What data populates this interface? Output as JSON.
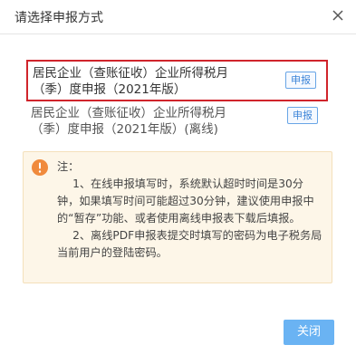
{
  "dialog": {
    "title": "请选择申报方式",
    "close_icon": "close-icon"
  },
  "options": [
    {
      "label_line1": "居民企业（查账征收）企业所得税月",
      "label_line2": "（季）度申报（2021年版）",
      "button_label": "申报",
      "selected": true
    },
    {
      "label_line1": "居民企业（查账征收）企业所得税月",
      "label_line2": "（季）度申报（2021年版）(离线)",
      "button_label": "申报",
      "selected": false
    }
  ],
  "notice": {
    "icon": "warning-icon",
    "heading": "注：",
    "items": [
      "1、在线申报填写时，系统默认超时时间是30分钟，如果填写时间可能超过30分钟，建议使用申报中的“暂存”功能、或者使用离线申报表下载后填报。",
      "2、离线PDF申报表提交时填写的密码为电子税务局当前用户的登陆密码。"
    ]
  },
  "footer": {
    "close_label": "关闭"
  },
  "colors": {
    "selected_border": "#d0242b",
    "button_blue": "#6ab3f3",
    "link_blue": "#3d85d8",
    "notice_bg": "#fdf6e8",
    "warning_orange": "#f08a3c"
  }
}
